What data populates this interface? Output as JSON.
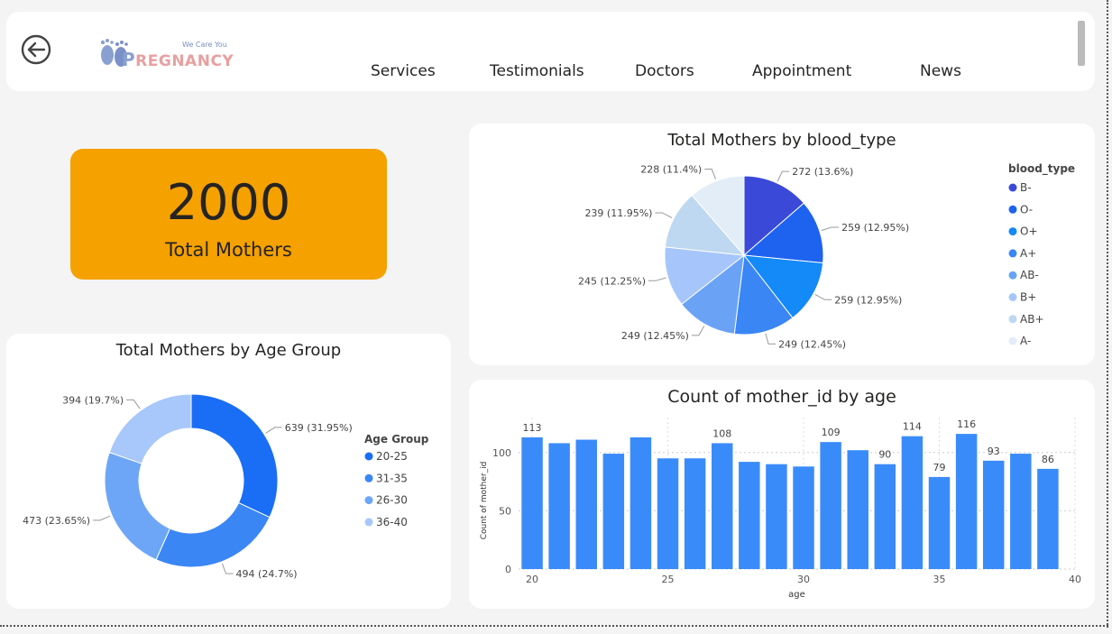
{
  "header": {
    "logo_tagline": "We Care You",
    "logo_brand_first": "P",
    "logo_brand_rest": "REGNANCY",
    "nav": [
      "Services",
      "Testimonials",
      "Doctors",
      "Appointment",
      "News"
    ]
  },
  "kpi": {
    "value": "2000",
    "label": "Total Mothers"
  },
  "colors": {
    "kpi_bg": "#f5a100"
  },
  "chart_data": [
    {
      "type": "pie",
      "title": "Total Mothers by blood_type",
      "legend_title": "blood_type",
      "legend_position": "right",
      "slices": [
        {
          "name": "B-",
          "value": 272,
          "label": "272 (13.6%)",
          "color": "#3a49d8"
        },
        {
          "name": "O-",
          "value": 259,
          "label": "259 (12.95%)",
          "color": "#1e62f0"
        },
        {
          "name": "O+",
          "value": 259,
          "label": "259 (12.95%)",
          "color": "#1489f8"
        },
        {
          "name": "A+",
          "value": 249,
          "label": "249 (12.45%)",
          "color": "#3a86f5"
        },
        {
          "name": "AB-",
          "value": 249,
          "label": "249 (12.45%)",
          "color": "#6aa3f6"
        },
        {
          "name": "B+",
          "value": 245,
          "label": "245 (12.25%)",
          "color": "#a6c6fb"
        },
        {
          "name": "AB+",
          "value": 239,
          "label": "239 (11.95%)",
          "color": "#bdd8f0"
        },
        {
          "name": "A-",
          "value": 228,
          "label": "228 (11.4%)",
          "color": "#e2edf8"
        }
      ]
    },
    {
      "type": "donut",
      "title": "Total Mothers by Age Group",
      "legend_title": "Age Group",
      "legend_position": "right",
      "slices": [
        {
          "name": "20-25",
          "value": 639,
          "label": "639 (31.95%)",
          "color": "#1a6ef5"
        },
        {
          "name": "31-35",
          "value": 494,
          "label": "494 (24.7%)",
          "color": "#3a86f5"
        },
        {
          "name": "26-30",
          "value": 473,
          "label": "473 (23.65%)",
          "color": "#6ea6f7"
        },
        {
          "name": "36-40",
          "value": 394,
          "label": "394 (19.7%)",
          "color": "#a8c7fb"
        }
      ]
    },
    {
      "type": "bar",
      "title": "Count of mother_id by age",
      "xlabel": "age",
      "ylabel": "Count of mother_id",
      "x": [
        20,
        21,
        22,
        23,
        24,
        25,
        26,
        27,
        28,
        29,
        30,
        31,
        32,
        33,
        34,
        35,
        36,
        37,
        38,
        39
      ],
      "values": [
        113,
        108,
        111,
        99,
        113,
        95,
        95,
        108,
        92,
        90,
        88,
        109,
        102,
        90,
        114,
        79,
        116,
        93,
        99,
        86
      ],
      "labeled": [
        113,
        108,
        109,
        90,
        114,
        79,
        116,
        93,
        86
      ],
      "labeled_ages": [
        20,
        27,
        31,
        33,
        34,
        35,
        36,
        37,
        39
      ],
      "x_ticks": [
        20,
        25,
        30,
        35,
        40
      ],
      "y_ticks": [
        0,
        50,
        100
      ],
      "ylim": [
        0,
        130
      ],
      "xlim": [
        19.5,
        40
      ],
      "color": "#3a8bfa",
      "grid": true
    }
  ]
}
